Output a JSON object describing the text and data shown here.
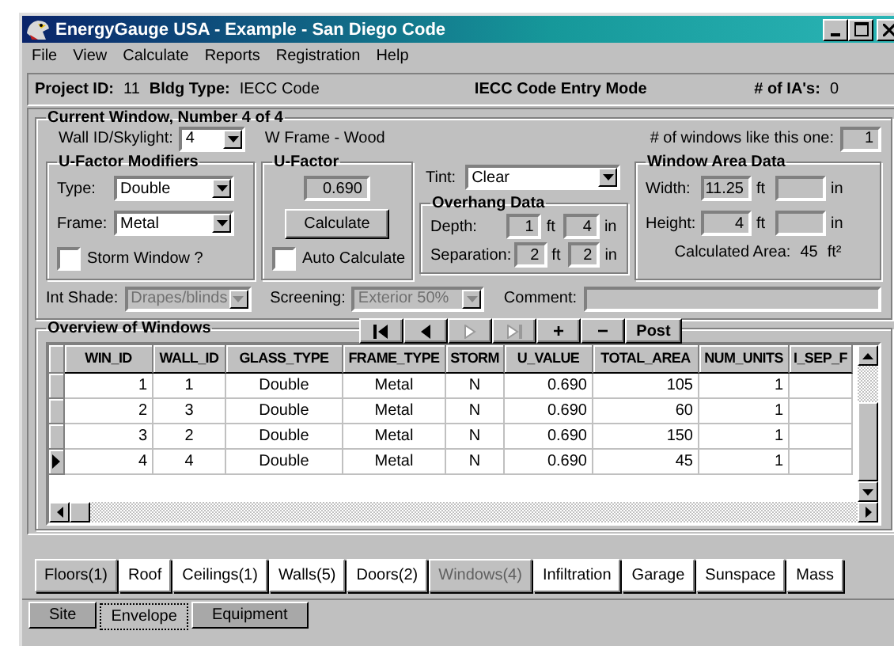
{
  "window": {
    "title": "EnergyGauge USA - Example - San Diego Code"
  },
  "menu": [
    "File",
    "View",
    "Calculate",
    "Reports",
    "Registration",
    "Help"
  ],
  "header": {
    "project_label": "Project ID:",
    "project_id": "11",
    "bldg_label": "Bldg Type:",
    "bldg_type": "IECC Code",
    "mode": "IECC Code Entry Mode",
    "ia_label": "# of IA's:",
    "ia_value": "0"
  },
  "current": {
    "title": "Current Window, Number 4 of 4",
    "wall_label": "Wall ID/Skylight:",
    "wall_id": "4",
    "wall_desc": "W  Frame - Wood",
    "like_label": "# of windows like this one:",
    "like_value": "1",
    "modifiers": {
      "title": "U-Factor Modifiers",
      "type_label": "Type:",
      "type": "Double",
      "frame_label": "Frame:",
      "frame": "Metal",
      "storm_label": "Storm Window ?",
      "storm_checked": false
    },
    "ufactor": {
      "title": "U-Factor",
      "value": "0.690",
      "button": "Calculate",
      "auto_label": "Auto Calculate",
      "auto_checked": false
    },
    "tint_label": "Tint:",
    "tint": "Clear",
    "overhang": {
      "title": "Overhang Data",
      "rows": [
        {
          "label": "Depth:",
          "ft": "1",
          "ft_unit": "ft",
          "in": "4",
          "in_unit": "in"
        },
        {
          "label": "Separation:",
          "ft": "2",
          "ft_unit": "ft",
          "in": "2",
          "in_unit": "in"
        }
      ]
    },
    "area": {
      "title": "Window Area Data",
      "rows": [
        {
          "label": "Width:",
          "ft": "11.25",
          "ft_unit": "ft",
          "in_unit": "in"
        },
        {
          "label": "Height:",
          "ft": "4",
          "ft_unit": "ft",
          "in_unit": "in"
        }
      ],
      "calc_label": "Calculated Area:",
      "calc_value": "45",
      "calc_unit": "ft²"
    },
    "shade_label": "Int Shade:",
    "shade": "Drapes/blinds",
    "shade_disabled": true,
    "screen_label": "Screening:",
    "screening": "Exterior 50%",
    "screen_disabled": true,
    "comment_label": "Comment:"
  },
  "overview": {
    "title": "Overview of Windows",
    "nav": [
      {
        "kind": "first",
        "disabled": false
      },
      {
        "kind": "prior",
        "disabled": false
      },
      {
        "kind": "next",
        "disabled": true
      },
      {
        "kind": "last",
        "disabled": true
      },
      {
        "kind": "text",
        "label": "+",
        "disabled": false
      },
      {
        "kind": "text",
        "label": "−",
        "disabled": false
      },
      {
        "kind": "text",
        "label": "Post",
        "disabled": false
      }
    ],
    "table": {
      "columns": [
        "WIN_ID",
        "WALL_ID",
        "GLASS_TYPE",
        "FRAME_TYPE",
        "STORM",
        "U_VALUE",
        "TOTAL_AREA",
        "NUM_UNITS",
        "I_SEP_F"
      ],
      "rows": [
        {
          "current": false,
          "cells": [
            "1",
            "1",
            "Double",
            "Metal",
            "N",
            "0.690",
            "105",
            "1"
          ]
        },
        {
          "current": false,
          "cells": [
            "2",
            "3",
            "Double",
            "Metal",
            "N",
            "0.690",
            "60",
            "1"
          ]
        },
        {
          "current": false,
          "cells": [
            "3",
            "2",
            "Double",
            "Metal",
            "N",
            "0.690",
            "150",
            "1"
          ]
        },
        {
          "current": true,
          "cells": [
            "4",
            "4",
            "Double",
            "Metal",
            "N",
            "0.690",
            "45",
            "1"
          ]
        }
      ]
    }
  },
  "sections": [
    {
      "label": "Floors(1)",
      "pressed": true,
      "disabled": false
    },
    {
      "label": "Roof",
      "pressed": false,
      "disabled": false
    },
    {
      "label": "Ceilings(1)",
      "pressed": false,
      "disabled": false
    },
    {
      "label": "Walls(5)",
      "pressed": false,
      "disabled": false
    },
    {
      "label": "Doors(2)",
      "pressed": false,
      "disabled": false
    },
    {
      "label": "Windows(4)",
      "pressed": true,
      "disabled": true
    },
    {
      "label": "Infiltration",
      "pressed": false,
      "disabled": false
    },
    {
      "label": "Garage",
      "pressed": false,
      "disabled": false
    },
    {
      "label": "Sunspace",
      "pressed": false,
      "disabled": false
    },
    {
      "label": "Mass",
      "pressed": false,
      "disabled": false
    }
  ],
  "tabs": [
    {
      "label": "Site",
      "selected": false
    },
    {
      "label": "Envelope",
      "selected": true
    },
    {
      "label": "Equipment",
      "selected": false
    }
  ]
}
